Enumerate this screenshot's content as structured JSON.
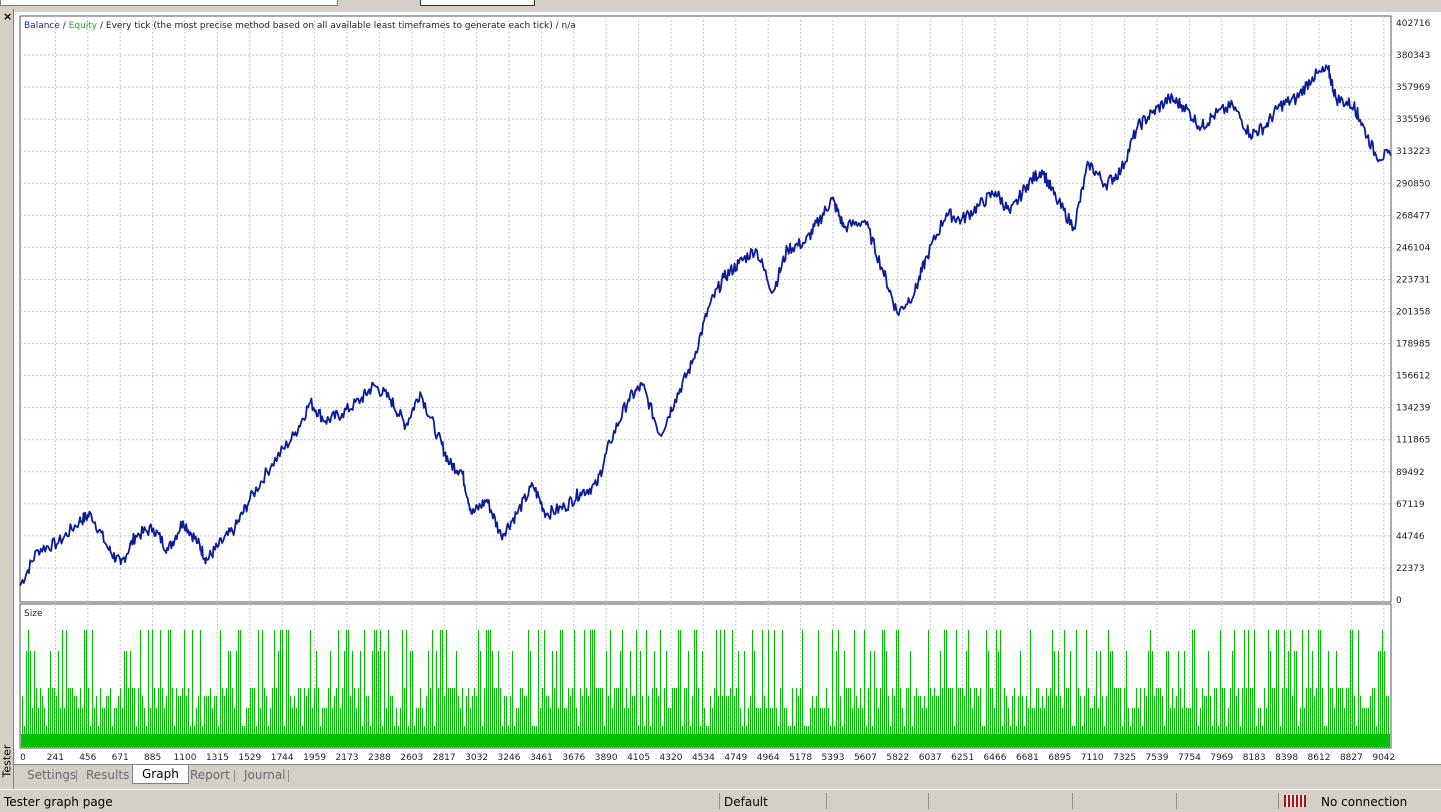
{
  "window": {
    "close_glyph": "×",
    "panel_title": "Tester"
  },
  "chart": {
    "legend": {
      "balance": "Balance",
      "sep1": " / ",
      "equity": "Equity",
      "rest": " / Every tick (the most precise method based on all available least timeframes to generate each tick) / n/a"
    },
    "y_ticks": [
      "402716",
      "380343",
      "357969",
      "335596",
      "313223",
      "290850",
      "268477",
      "246104",
      "223731",
      "201358",
      "178985",
      "156612",
      "134239",
      "111865",
      "89492",
      "67119",
      "44746",
      "22373",
      "0"
    ],
    "x_ticks": [
      "0",
      "241",
      "456",
      "671",
      "885",
      "1100",
      "1315",
      "1529",
      "1744",
      "1959",
      "2173",
      "2388",
      "2603",
      "2817",
      "3032",
      "3246",
      "3461",
      "3676",
      "3890",
      "4105",
      "4320",
      "4534",
      "4749",
      "4964",
      "5178",
      "5393",
      "5607",
      "5822",
      "6037",
      "6251",
      "6466",
      "6681",
      "6895",
      "7110",
      "7325",
      "7539",
      "7754",
      "7969",
      "8183",
      "8398",
      "8612",
      "8827",
      "9042"
    ],
    "size_label": "Size",
    "colors": {
      "balance": "#0b1d99",
      "equity": "#1eb01e",
      "size_bars": "#00c000",
      "grid": "#c8c8c8"
    }
  },
  "chart_data": {
    "type": "line",
    "x_range": [
      0,
      9250
    ],
    "y_range": [
      0,
      402716
    ],
    "series": [
      {
        "name": "Balance",
        "points": [
          [
            0,
            10000
          ],
          [
            120,
            35000
          ],
          [
            260,
            40000
          ],
          [
            400,
            55000
          ],
          [
            480,
            60000
          ],
          [
            600,
            35000
          ],
          [
            680,
            25000
          ],
          [
            780,
            45000
          ],
          [
            900,
            50000
          ],
          [
            1000,
            35000
          ],
          [
            1100,
            55000
          ],
          [
            1200,
            40000
          ],
          [
            1260,
            28000
          ],
          [
            1340,
            38000
          ],
          [
            1450,
            50000
          ],
          [
            1550,
            70000
          ],
          [
            1700,
            95000
          ],
          [
            1850,
            115000
          ],
          [
            1959,
            138000
          ],
          [
            2060,
            125000
          ],
          [
            2173,
            130000
          ],
          [
            2300,
            140000
          ],
          [
            2388,
            150000
          ],
          [
            2500,
            140000
          ],
          [
            2603,
            122000
          ],
          [
            2700,
            145000
          ],
          [
            2817,
            115000
          ],
          [
            2900,
            95000
          ],
          [
            2980,
            90000
          ],
          [
            3050,
            60000
          ],
          [
            3150,
            70000
          ],
          [
            3246,
            45000
          ],
          [
            3350,
            60000
          ],
          [
            3461,
            80000
          ],
          [
            3550,
            60000
          ],
          [
            3676,
            65000
          ],
          [
            3780,
            75000
          ],
          [
            3890,
            80000
          ],
          [
            3980,
            110000
          ],
          [
            4105,
            140000
          ],
          [
            4200,
            150000
          ],
          [
            4320,
            115000
          ],
          [
            4420,
            140000
          ],
          [
            4534,
            165000
          ],
          [
            4650,
            205000
          ],
          [
            4749,
            225000
          ],
          [
            4850,
            235000
          ],
          [
            4964,
            245000
          ],
          [
            5080,
            215000
          ],
          [
            5178,
            245000
          ],
          [
            5300,
            250000
          ],
          [
            5393,
            265000
          ],
          [
            5480,
            280000
          ],
          [
            5560,
            260000
          ],
          [
            5700,
            265000
          ],
          [
            5822,
            230000
          ],
          [
            5920,
            200000
          ],
          [
            6037,
            215000
          ],
          [
            6120,
            240000
          ],
          [
            6251,
            270000
          ],
          [
            6350,
            265000
          ],
          [
            6466,
            275000
          ],
          [
            6581,
            285000
          ],
          [
            6681,
            270000
          ],
          [
            6795,
            290000
          ],
          [
            6895,
            300000
          ],
          [
            6990,
            280000
          ],
          [
            7110,
            260000
          ],
          [
            7210,
            305000
          ],
          [
            7325,
            290000
          ],
          [
            7430,
            300000
          ],
          [
            7539,
            330000
          ],
          [
            7640,
            340000
          ],
          [
            7754,
            350000
          ],
          [
            7850,
            345000
          ],
          [
            7969,
            330000
          ],
          [
            8050,
            338000
          ],
          [
            8183,
            345000
          ],
          [
            8300,
            325000
          ],
          [
            8398,
            330000
          ],
          [
            8500,
            345000
          ],
          [
            8612,
            350000
          ],
          [
            8720,
            365000
          ],
          [
            8827,
            370000
          ],
          [
            8880,
            350000
          ],
          [
            9000,
            345000
          ],
          [
            9042,
            335000
          ],
          [
            9150,
            310000
          ],
          [
            9250,
            310000
          ]
        ]
      },
      {
        "name": "Equity",
        "points": []
      }
    ],
    "size_panel": {
      "label": "Size"
    }
  },
  "tabs": [
    {
      "label": "Settings",
      "active": false
    },
    {
      "label": "Results",
      "active": false
    },
    {
      "label": "Graph",
      "active": true
    },
    {
      "label": "Report",
      "active": false
    },
    {
      "label": "Journal",
      "active": false
    }
  ],
  "statusbar": {
    "page": "Tester graph page",
    "profile": "Default",
    "connection": "No connection"
  }
}
